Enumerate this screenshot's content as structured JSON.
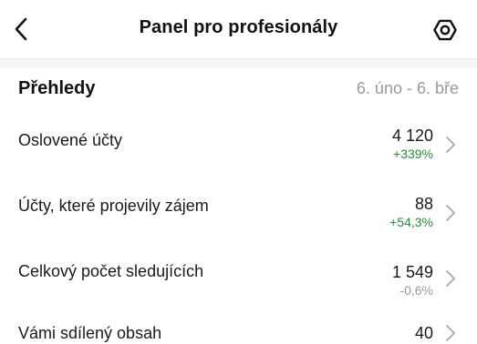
{
  "header": {
    "title": "Panel pro profesionály"
  },
  "insights": {
    "title": "Přehledy",
    "date_range": "6. úno - 6. bře",
    "rows": [
      {
        "label": "Oslovené účty",
        "value": "4 120",
        "change": "+339%",
        "change_color": "#2e8b3a"
      },
      {
        "label": "Účty, které projevily zájem",
        "value": "88",
        "change": "+54,3%",
        "change_color": "#2e8b3a"
      },
      {
        "label": "Celkový počet sledujících",
        "value": "1 549",
        "change": "-0,6%",
        "change_color": "#9a9a9a"
      },
      {
        "label": "Vámi sdílený obsah",
        "value": "40",
        "change": ""
      }
    ]
  },
  "icons": {
    "back": "chevron-left-icon",
    "settings": "gear-icon",
    "row_arrow": "chevron-right-icon"
  }
}
